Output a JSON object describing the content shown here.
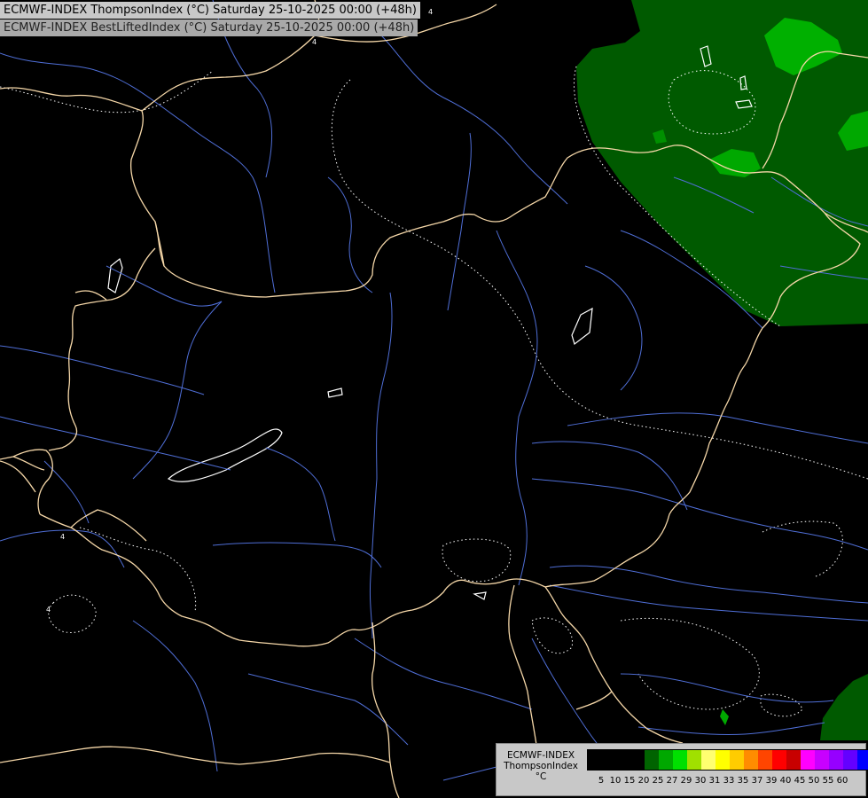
{
  "header": {
    "line1": "ECMWF-INDEX ThompsonIndex (°C) Saturday 25-10-2025 00:00 (+48h)",
    "line2": "ECMWF-INDEX BestLiftedIndex (°C) Saturday 25-10-2025 00:00 (+48h)"
  },
  "map": {
    "background_color": "#000000",
    "border_color": "#f5d7a8",
    "river_color": "#4f6ed6",
    "contour_color": "#ffffff",
    "fill_dark_green": "#005a00",
    "fill_green": "#00a000",
    "fill_bright_green": "#00c000"
  },
  "legend": {
    "title_line1": "ECMWF-INDEX",
    "title_line2": "ThompsonIndex",
    "title_line3": "°C",
    "colors": [
      "#000000",
      "#000000",
      "#000000",
      "#000000",
      "#006400",
      "#00a800",
      "#00e000",
      "#a0e000",
      "#ffff70",
      "#ffff00",
      "#ffcc00",
      "#ff8c00",
      "#ff4500",
      "#ff0000",
      "#c80000",
      "#ff00ff",
      "#c800ff",
      "#9600ff",
      "#6400ff",
      "#0000ff"
    ],
    "ticks": [
      "5",
      "10",
      "15",
      "20",
      "25",
      "27",
      "29",
      "30",
      "31",
      "33",
      "35",
      "37",
      "39",
      "40",
      "45",
      "50",
      "55",
      "60"
    ]
  }
}
